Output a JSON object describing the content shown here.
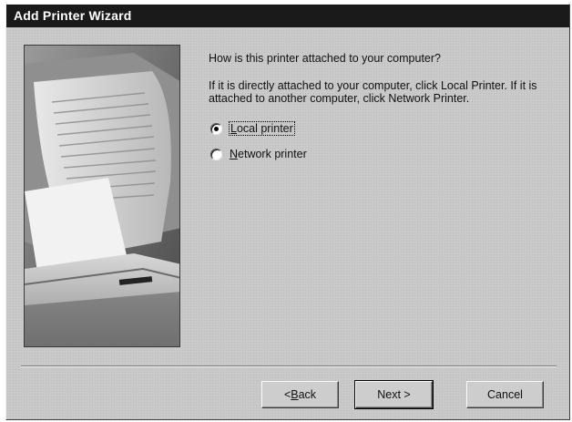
{
  "window": {
    "title": "Add Printer Wizard"
  },
  "wizard": {
    "question": "How is this printer attached to your computer?",
    "instruction": "If it is directly attached to your computer, click Local Printer. If it is attached to another computer, click Network Printer.",
    "options": [
      {
        "label": "Local printer",
        "mnemonic": "L",
        "rest": "ocal printer",
        "selected": true
      },
      {
        "label": "Network printer",
        "mnemonic": "N",
        "rest": "etwork printer",
        "selected": false
      }
    ]
  },
  "buttons": {
    "back": {
      "prefix": "< ",
      "mnemonic": "B",
      "rest": "ack"
    },
    "next": "Next >",
    "cancel": "Cancel"
  },
  "image": {
    "icon": "printer-illustration"
  }
}
